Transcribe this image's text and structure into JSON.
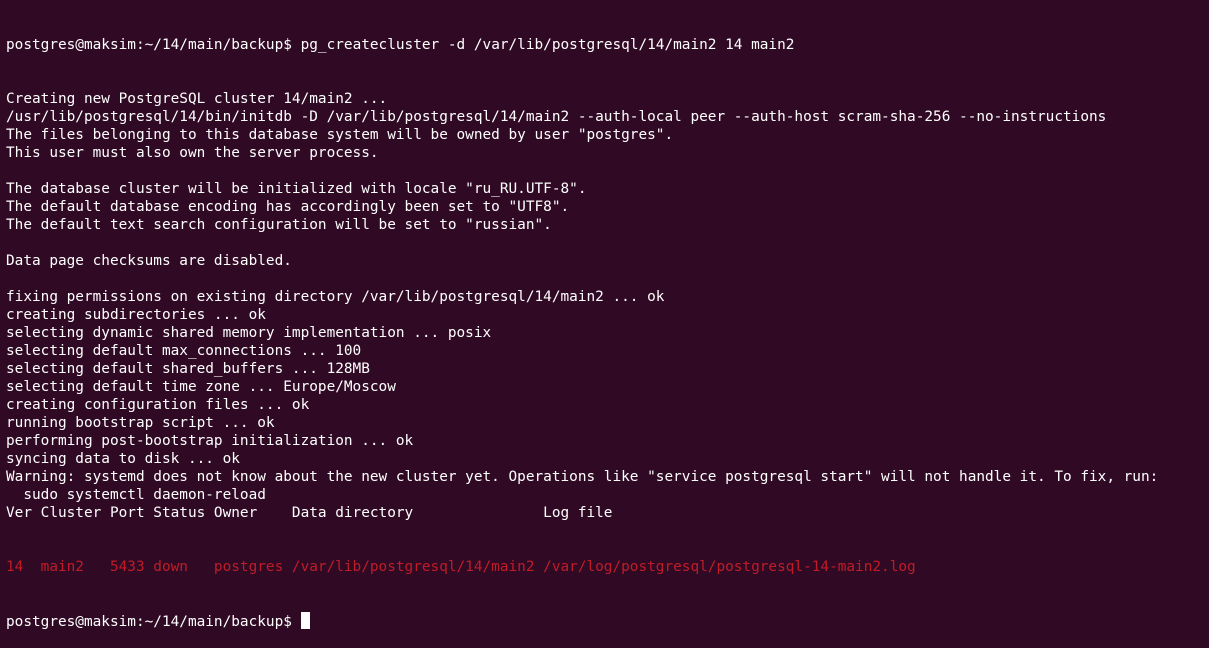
{
  "terminal": {
    "prompt": "postgres@maksim:~/14/main/backup$",
    "command": " pg_createcluster -d /var/lib/postgresql/14/main2 14 main2",
    "output": [
      "Creating new PostgreSQL cluster 14/main2 ...",
      "/usr/lib/postgresql/14/bin/initdb -D /var/lib/postgresql/14/main2 --auth-local peer --auth-host scram-sha-256 --no-instructions",
      "The files belonging to this database system will be owned by user \"postgres\".",
      "This user must also own the server process.",
      "",
      "The database cluster will be initialized with locale \"ru_RU.UTF-8\".",
      "The default database encoding has accordingly been set to \"UTF8\".",
      "The default text search configuration will be set to \"russian\".",
      "",
      "Data page checksums are disabled.",
      "",
      "fixing permissions on existing directory /var/lib/postgresql/14/main2 ... ok",
      "creating subdirectories ... ok",
      "selecting dynamic shared memory implementation ... posix",
      "selecting default max_connections ... 100",
      "selecting default shared_buffers ... 128MB",
      "selecting default time zone ... Europe/Moscow",
      "creating configuration files ... ok",
      "running bootstrap script ... ok",
      "performing post-bootstrap initialization ... ok",
      "syncing data to disk ... ok",
      "Warning: systemd does not know about the new cluster yet. Operations like \"service postgresql start\" will not handle it. To fix, run:",
      "  sudo systemctl daemon-reload",
      "Ver Cluster Port Status Owner    Data directory               Log file"
    ],
    "cluster_row": "14  main2   5433 down   postgres /var/lib/postgresql/14/main2 /var/log/postgresql/postgresql-14-main2.log",
    "final_prompt": "postgres@maksim:~/14/main/backup$",
    "colors": {
      "background": "#300a24",
      "text": "#ffffff",
      "down_row": "#c01c28"
    }
  }
}
